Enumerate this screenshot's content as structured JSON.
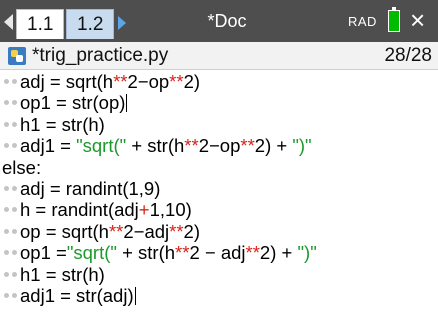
{
  "tabs": [
    {
      "label": "1.1",
      "active": true
    },
    {
      "label": "1.2",
      "active": false
    }
  ],
  "document_title": "*Doc",
  "mode": "RAD",
  "editor": {
    "file_name": "*trig_practice.py",
    "line_position": "28/28"
  },
  "code_lines": [
    {
      "indent": true,
      "parts": [
        {
          "t": "adj = sqrt(h"
        },
        {
          "t": "**",
          "c": "op"
        },
        {
          "t": "2"
        },
        {
          "t": "−",
          "c": "plain"
        },
        {
          "t": "op"
        },
        {
          "t": "**",
          "c": "op"
        },
        {
          "t": "2)"
        }
      ]
    },
    {
      "indent": true,
      "parts": [
        {
          "t": "op1 = str(op)"
        }
      ],
      "caret_after": true
    },
    {
      "indent": true,
      "parts": [
        {
          "t": "h1 = str(h)"
        }
      ]
    },
    {
      "indent": true,
      "parts": [
        {
          "t": "adj1 = "
        },
        {
          "t": "\"sqrt(\"",
          "c": "str"
        },
        {
          "t": " + str(h"
        },
        {
          "t": "**",
          "c": "op"
        },
        {
          "t": "2−op"
        },
        {
          "t": "**",
          "c": "op"
        },
        {
          "t": "2) + "
        },
        {
          "t": "\")\"",
          "c": "str"
        }
      ]
    },
    {
      "indent": false,
      "parts": [
        {
          "t": "else:"
        }
      ]
    },
    {
      "indent": true,
      "parts": [
        {
          "t": "adj = randint(1,9)"
        }
      ]
    },
    {
      "indent": true,
      "parts": [
        {
          "t": "h = randint(adj"
        },
        {
          "t": "+",
          "c": "op"
        },
        {
          "t": "1,10)"
        }
      ]
    },
    {
      "indent": true,
      "parts": [
        {
          "t": "op = sqrt(h"
        },
        {
          "t": "**",
          "c": "op"
        },
        {
          "t": "2−adj"
        },
        {
          "t": "**",
          "c": "op"
        },
        {
          "t": "2)"
        }
      ]
    },
    {
      "indent": true,
      "parts": [
        {
          "t": "op1 ="
        },
        {
          "t": "\"sqrt(\"",
          "c": "str"
        },
        {
          "t": " + str(h"
        },
        {
          "t": "**",
          "c": "op"
        },
        {
          "t": "2 − adj"
        },
        {
          "t": "**",
          "c": "op"
        },
        {
          "t": "2) + "
        },
        {
          "t": "\")\"",
          "c": "str"
        }
      ]
    },
    {
      "indent": true,
      "parts": [
        {
          "t": "h1 = str(h)"
        }
      ]
    },
    {
      "indent": true,
      "parts": [
        {
          "t": "adj1 = str(adj)"
        }
      ],
      "caret_end": true
    }
  ],
  "icons": {
    "tab_left": "chevron-left-icon",
    "tab_right": "chevron-right-icon",
    "battery": "battery-icon",
    "close": "close-icon",
    "python_file": "python-file-icon"
  },
  "colors": {
    "tabbar_bg": "#4e4e4e",
    "string": "#1c9a2c",
    "operator": "#d9241b",
    "battery": "#00bb00"
  }
}
